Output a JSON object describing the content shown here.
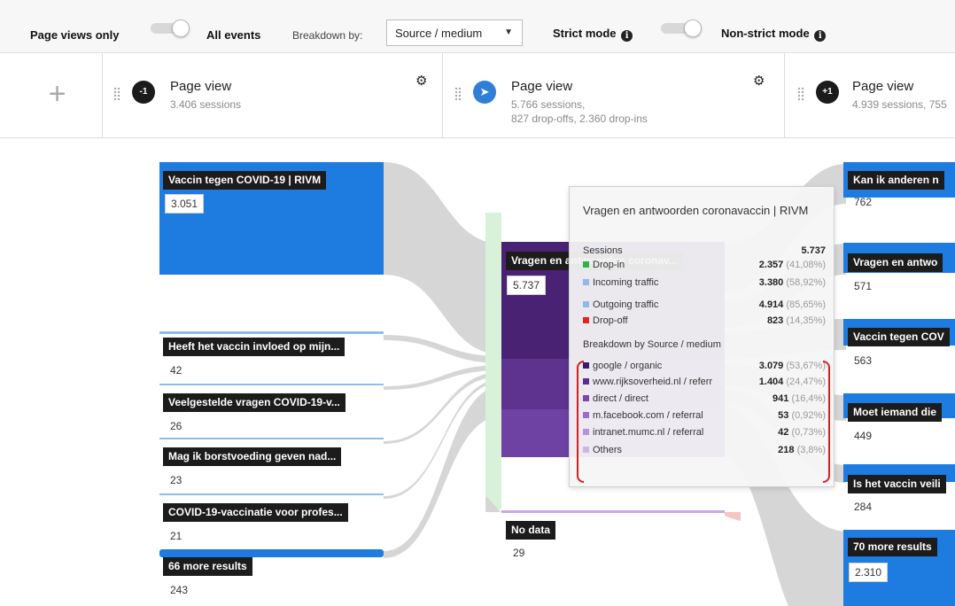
{
  "toolbar": {
    "page_views_only": "Page views only",
    "all_events": "All events",
    "breakdown_by": "Breakdown by:",
    "breakdown_value": "Source / medium",
    "strict_mode": "Strict mode",
    "non_strict_mode": "Non-strict mode",
    "info_glyph": "i"
  },
  "add_step": "+",
  "steps": [
    {
      "badge": "-1",
      "title": "Page view",
      "sub1": "3.406 sessions",
      "sub2": ""
    },
    {
      "badge": "",
      "title": "Page view",
      "sub1": "5.766 sessions,",
      "sub2": "827 drop-offs, 2.360 drop-ins"
    },
    {
      "badge": "+1",
      "title": "Page view",
      "sub1": "4.939 sessions, 755",
      "sub2": ""
    }
  ],
  "left_nodes": [
    {
      "label": "Vaccin tegen COVID-19 | RIVM",
      "count": "3.051"
    },
    {
      "label": "Heeft het vaccin invloed op mijn...",
      "count": "42"
    },
    {
      "label": "Veelgestelde vragen COVID-19-v...",
      "count": "26"
    },
    {
      "label": "Mag ik borstvoeding geven nad...",
      "count": "23"
    },
    {
      "label": "COVID-19-vaccinatie voor profes...",
      "count": "21"
    },
    {
      "label": "66 more results",
      "count": "243"
    }
  ],
  "center_nodes": [
    {
      "label": "Vragen en antwoorden coronav...",
      "count": "5.737"
    },
    {
      "label": "No data",
      "count": "29"
    }
  ],
  "right_nodes": [
    {
      "label": "Kan ik anderen n",
      "count": "762"
    },
    {
      "label": "Vragen en antwo",
      "count": "571"
    },
    {
      "label": "Vaccin tegen COV",
      "count": "563"
    },
    {
      "label": "Moet iemand die",
      "count": "449"
    },
    {
      "label": "Is het vaccin veili",
      "count": "284"
    },
    {
      "label": "70 more results",
      "count": "2.310"
    }
  ],
  "tooltip": {
    "title": "Vragen en antwoorden coronavaccin | RIVM",
    "sessions_label": "Sessions",
    "sessions_value": "5.737",
    "metrics": [
      {
        "label": "Drop-in",
        "value": "2.357",
        "pct": "(41,08%)",
        "color": "#2db34a"
      },
      {
        "label": "Incoming traffic",
        "value": "3.380",
        "pct": "(58,92%)",
        "color": "#8fb8ec"
      },
      {
        "label": "Outgoing traffic",
        "value": "4.914",
        "pct": "(85,65%)",
        "color": "#8fb8ec"
      },
      {
        "label": "Drop-off",
        "value": "823",
        "pct": "(14,35%)",
        "color": "#e02424"
      }
    ],
    "breakdown_heading": "Breakdown by Source / medium",
    "breakdown": [
      {
        "label": "google / organic",
        "value": "3.079",
        "pct": "(53,67%)",
        "color": "#3d1a6e"
      },
      {
        "label": "www.rijksoverheid.nl / referr",
        "value": "1.404",
        "pct": "(24,47%)",
        "color": "#5a2d91"
      },
      {
        "label": "direct / direct",
        "value": "941",
        "pct": "(16,4%)",
        "color": "#7b45b0"
      },
      {
        "label": "m.facebook.com / referral",
        "value": "53",
        "pct": "(0,92%)",
        "color": "#9c6cc9"
      },
      {
        "label": "intranet.mumc.nl / referral",
        "value": "42",
        "pct": "(0,73%)",
        "color": "#b493d8"
      },
      {
        "label": "Others",
        "value": "218",
        "pct": "(3,8%)",
        "color": "#cdb6e6"
      }
    ]
  },
  "colors": {
    "node_blue": "#1e7be0",
    "center_purple": "#4a2274",
    "flow_gray": "#d6d6d6",
    "drop_in_green": "#cfeccf"
  },
  "icons": {
    "gear": "gear-icon",
    "rocket": "rocket-icon",
    "info": "info-icon",
    "drag": "drag-handle-icon",
    "chevron": "chevron-down-icon",
    "plus": "plus-icon"
  }
}
